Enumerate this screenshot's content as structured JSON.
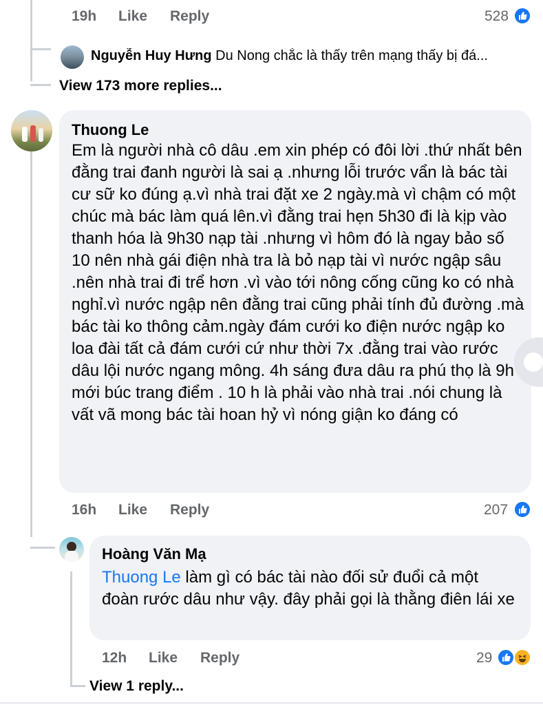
{
  "top_comment": {
    "time": "19h",
    "like_label": "Like",
    "reply_label": "Reply",
    "reaction_count": "528",
    "reply_preview": {
      "author": "Nguyễn Huy Hưng",
      "text": "Du Nong chắc là thấy trên mạng thấy bị đá..."
    },
    "view_more": "View 173 more replies..."
  },
  "comment_thuong": {
    "author": "Thuong Le",
    "text": "Em là người nhà cô dâu .em xin phép có đôi lời .thứ nhất bên đằng trai đanh người là sai ạ .nhưng lỗi trước vẩn là bác tài cư sữ ko đúng ạ.vì nhà trai đặt xe 2 ngày.mà vì chậm có một chúc mà bác làm quá lên.vì đằng trai hẹn 5h30 đi là kịp vào thanh hóa là 9h30 nạp tài .nhưng vì hôm đó là ngay bảo số 10 nên nhà gái điện nhà tra là bỏ nạp tài vì nước ngập sâu .nên nhà trai đi trể hơn .vì vào tới nông cống cũng ko có nhà nghỉ.vì nước ngập nên đằng trai cũng phải tính đủ đường .mà bác tài ko thông cảm.ngày đám cưới ko điện nước ngập ko loa đài tất cả đám cưới cứ như thời 7x .đằng trai vào rước dâu lội nước ngang mông. 4h sáng đưa dâu ra phú thọ là 9h mới búc trang điểm . 10 h là phải vào nhà trai .nói chung là vất vã mong bác tài hoan hỷ vì nóng giận ko đáng có",
    "time": "16h",
    "like_label": "Like",
    "reply_label": "Reply",
    "reaction_count": "207"
  },
  "reply_hoang": {
    "author": "Hoàng Văn Mạ",
    "mention": "Thuong Le",
    "text": " làm gì có bác tài nào đối sử  đuổi cả một đoàn rước dâu như vậy. đây phải gọi là thằng điên lái xe",
    "time": "12h",
    "like_label": "Like",
    "reply_label": "Reply",
    "reaction_count": "29",
    "view_more": "View 1 reply..."
  },
  "icons": {
    "like": "like-reaction-icon",
    "haha": "haha-reaction-icon"
  },
  "colors": {
    "accent": "#1877f2",
    "bubble": "#f0f2f5",
    "meta": "#65676b"
  }
}
